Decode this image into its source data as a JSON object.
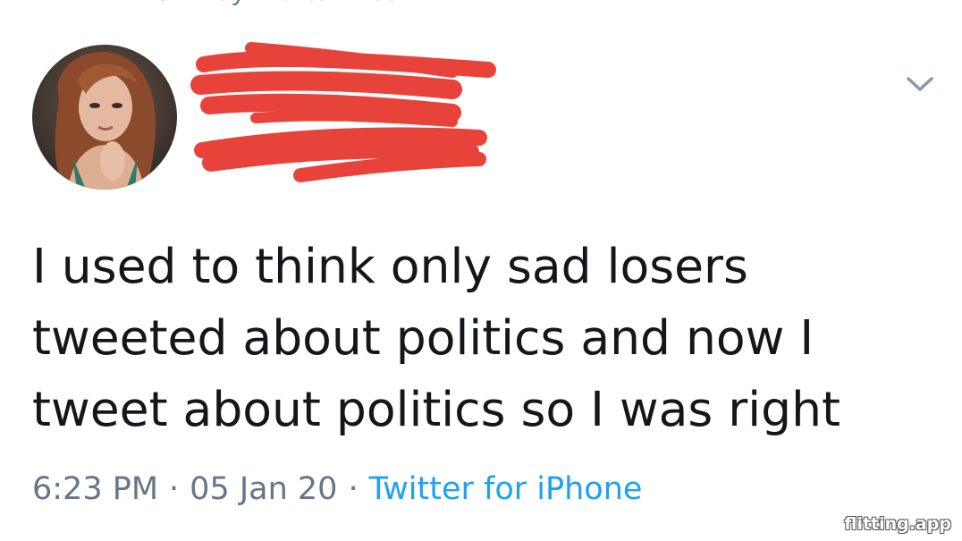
{
  "social_context": {
    "icon": "heart-icon",
    "text": "Andy Richter liked"
  },
  "author": {
    "avatar": "profile-photo",
    "name": "",
    "handle": "",
    "redaction_color": "#e8433a"
  },
  "tweet": {
    "lines": [
      "I used to think only sad losers",
      "tweeted about politics and now I",
      "tweet about politics so I was right"
    ]
  },
  "meta": {
    "time": "6:23 PM",
    "separator": "·",
    "date": "05 Jan 20",
    "source": "Twitter for iPhone"
  },
  "watermark": "flitting.app",
  "colors": {
    "text": "#14171a",
    "secondary": "#657786",
    "link": "#1da1f2"
  }
}
